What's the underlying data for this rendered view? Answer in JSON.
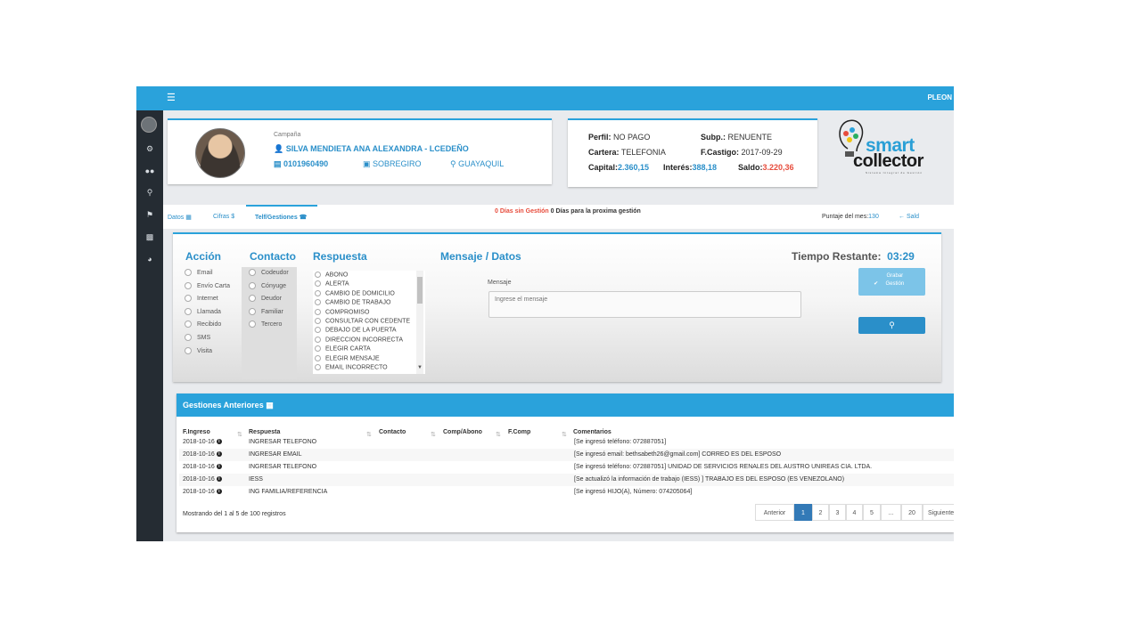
{
  "topbar": {
    "menu_icon": "hamburger-icon",
    "user": "PLEON"
  },
  "sidebar": {
    "icons": [
      "avatar",
      "gear-icon",
      "users-icon",
      "search-icon",
      "flag-icon",
      "money-icon",
      "chart-icon"
    ]
  },
  "debtor": {
    "campaign_label": "Campaña",
    "name": "SILVA MENDIETA ANA ALEXANDRA - LCEDEÑO",
    "id_number": "0101960490",
    "product": "SOBREGIRO",
    "city": "GUAYAQUIL"
  },
  "profile": {
    "perfil_label": "Perfil:",
    "perfil": "NO PAGO",
    "subp_label": "Subp.:",
    "subp": "RENUENTE",
    "cartera_label": "Cartera:",
    "cartera": "TELEFONIA",
    "fcastigo_label": "F.Castigo:",
    "fcastigo": "2017-09-29",
    "capital_label": "Capital:",
    "capital": "2.360,15",
    "interes_label": "Interés:",
    "interes": "388,18",
    "saldo_label": "Saldo:",
    "saldo": "3.220,36"
  },
  "logo": {
    "line1": "smart",
    "line2": "collector",
    "tagline": "Sistema Integral de Gestión"
  },
  "tabs": {
    "datos": "Datos",
    "cifras": "Cifras $",
    "telf": "Telf/Gestiones",
    "dias_sin_gestion": "0 Días sin Gestión",
    "dias_proxima": "0 Días para la proxima gestión",
    "puntaje_label": "Puntaje del mes:",
    "puntaje": "130",
    "saldo_link": "Sald"
  },
  "form": {
    "accion_title": "Acción",
    "accion_options": [
      "Email",
      "Envío Carta",
      "Internet",
      "Llamada",
      "Recibido",
      "SMS",
      "Visita"
    ],
    "contacto_title": "Contacto",
    "contacto_options": [
      "Codeudor",
      "Cónyuge",
      "Deudor",
      "Familiar",
      "Tercero"
    ],
    "respuesta_title": "Respuesta",
    "respuesta_options": [
      "ABONO",
      "ALERTA",
      "CAMBIO DE DOMICILIO",
      "CAMBIO DE TRABAJO",
      "COMPROMISO",
      "CONSULTAR CON CEDENTE",
      "DEBAJO DE LA PUERTA",
      "DIRECCION INCORRECTA",
      "ELEGIR CARTA",
      "ELEGIR MENSAJE",
      "EMAIL INCORRECTO"
    ],
    "mensaje_title": "Mensaje / Datos",
    "mensaje_label": "Mensaje",
    "mensaje_placeholder": "Ingrese el mensaje",
    "timer_label": "Tiempo Restante:",
    "timer_value": "03:29",
    "save_button": "Grabar Gestión"
  },
  "history": {
    "title": "Gestiones Anteriores",
    "columns": [
      "F.Ingreso",
      "Respuesta",
      "Contacto",
      "Comp/Abono",
      "F.Comp",
      "Comentarios"
    ],
    "rows": [
      {
        "fecha": "2018-10-16",
        "respuesta": "INGRESAR TELEFONO",
        "comentario": "[Se ingresó teléfono: 072887051]"
      },
      {
        "fecha": "2018-10-16",
        "respuesta": "INGRESAR EMAIL",
        "comentario": "[Se ingresó email: bethsabeth26@gmail.com] CORREO ES DEL ESPOSO"
      },
      {
        "fecha": "2018-10-16",
        "respuesta": "INGRESAR TELEFONO",
        "comentario": "[Se ingresó teléfono: 072887051] UNIDAD DE SERVICIOS RENALES DEL AUSTRO UNIREAS CIA. LTDA."
      },
      {
        "fecha": "2018-10-16",
        "respuesta": "IESS",
        "comentario": "[Se actualizó la información de trabajo (IESS) ] TRABAJO ES DEL ESPOSO (ES VENEZOLANO)"
      },
      {
        "fecha": "2018-10-16",
        "respuesta": "ING FAMILIA/REFERENCIA",
        "comentario": "[Se ingresó HIJO(A), Número: 074205064]"
      }
    ],
    "footer": "Mostrando del 1 al 5 de 100 registros",
    "pagination": [
      "Anterior",
      "1",
      "2",
      "3",
      "4",
      "5",
      "...",
      "20",
      "Siguiente"
    ]
  },
  "colors": {
    "accent": "#2aa2db",
    "link": "#2a8fc9",
    "danger": "#e74c3c",
    "sidebar": "#252c33"
  }
}
